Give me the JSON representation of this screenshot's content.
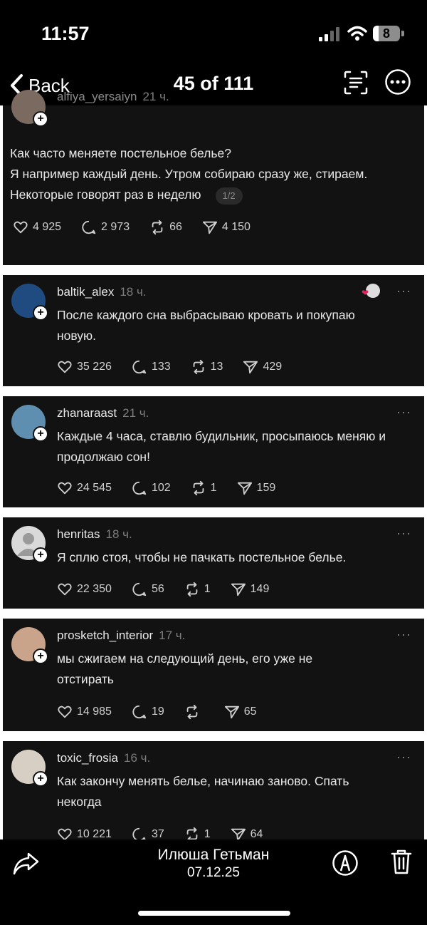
{
  "status_bar": {
    "time": "11:57",
    "battery": "8"
  },
  "header": {
    "back_label": "Back",
    "counter": "45 of 111"
  },
  "posts": [
    {
      "username": "alfiya_yersaiyn",
      "time": "21 ч.",
      "text": "Как часто меняете постельное белье?\nЯ например каждый день. Утром собираю сразу же, стираем.\nНекоторые говорят раз в неделю",
      "page_badge": "1/2",
      "likes": "4 925",
      "replies": "2 973",
      "reposts": "66",
      "shares": "4 150"
    },
    {
      "username": "baltik_alex",
      "time": "18 ч.",
      "text": "После каждого сна выбрасываю кровать и покупаю новую.",
      "likes": "35 226",
      "replies": "133",
      "reposts": "13",
      "shares": "429"
    },
    {
      "username": "zhanaraast",
      "time": "21 ч.",
      "text": "Каждые 4 часа, ставлю будильник, просыпаюсь меняю и продолжаю сон!",
      "likes": "24 545",
      "replies": "102",
      "reposts": "1",
      "shares": "159"
    },
    {
      "username": "henritas",
      "time": "18 ч.",
      "text": "Я сплю стоя, чтобы не пачкать постельное белье.",
      "likes": "22 350",
      "replies": "56",
      "reposts": "1",
      "shares": "149"
    },
    {
      "username": "prosketch_interior",
      "time": "17 ч.",
      "text": "мы сжигаем на следующий день, его уже не отстирать",
      "likes": "14 985",
      "replies": "19",
      "reposts": "",
      "shares": "65"
    },
    {
      "username": "toxic_frosia",
      "time": "16 ч.",
      "text": "Как закончу менять белье, начинаю заново. Спать некогда",
      "likes": "10 221",
      "replies": "37",
      "reposts": "1",
      "shares": "64"
    }
  ],
  "footer": {
    "author": "Илюша Гетьман",
    "date": "07.12.25"
  },
  "colors": {
    "background": "#000000",
    "card": "#121212",
    "separator": "#ffffff",
    "muted": "#7d7d7d"
  },
  "icons": [
    "back-chevron-icon",
    "text-recognition-icon",
    "more-icon",
    "heart-icon",
    "comment-icon",
    "repost-icon",
    "send-icon",
    "share-icon",
    "markup-icon",
    "trash-icon"
  ]
}
